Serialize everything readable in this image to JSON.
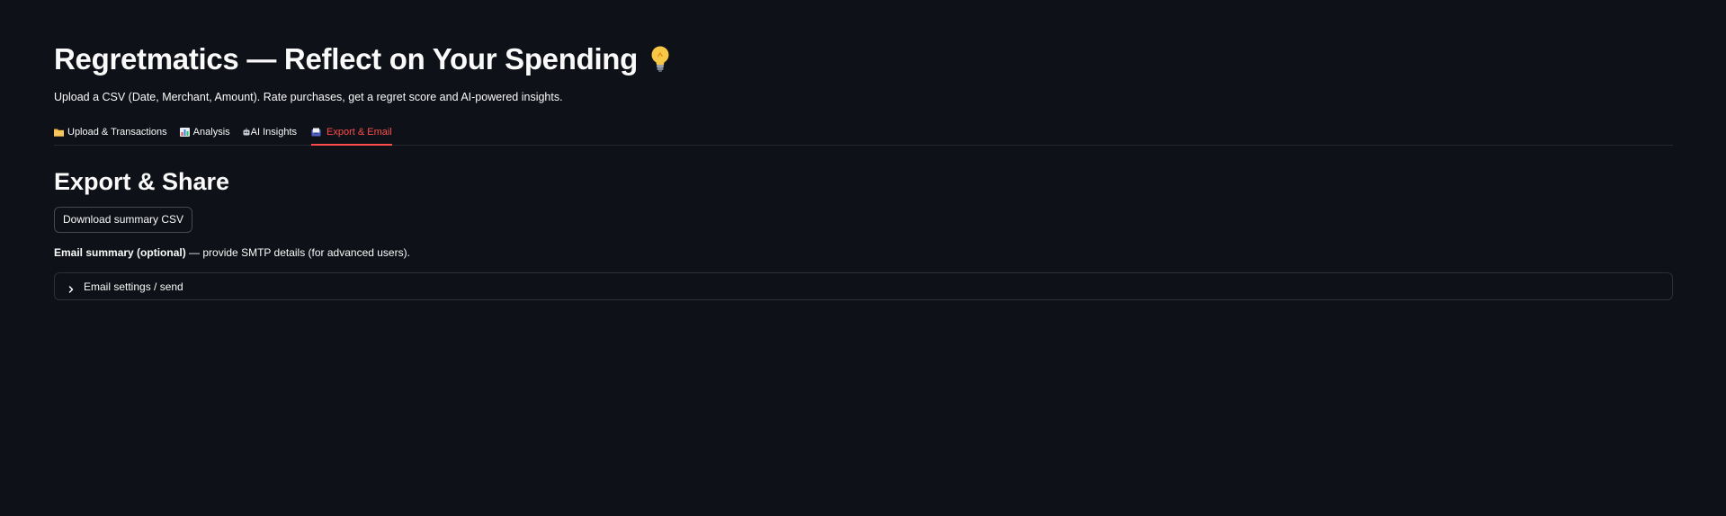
{
  "header": {
    "title": "Regretmatics — Reflect on Your Spending",
    "title_icon": "lightbulb-icon",
    "subtitle": "Upload a CSV (Date, Merchant, Amount). Rate purchases, get a regret score and AI-powered insights."
  },
  "tabs": [
    {
      "label": "Upload & Transactions",
      "icon": "folder-icon",
      "active": false
    },
    {
      "label": "Analysis",
      "icon": "bar-chart-icon",
      "active": false
    },
    {
      "label": "AI Insights",
      "icon": "robot-icon",
      "active": false
    },
    {
      "label": "Export & Email",
      "icon": "inbox-icon",
      "active": true
    }
  ],
  "export": {
    "heading": "Export & Share",
    "download_label": "Download summary CSV",
    "email_note_bold": "Email summary (optional)",
    "email_note_rest": " — provide SMTP details (for advanced users).",
    "expander_label": "Email settings / send"
  },
  "colors": {
    "background": "#0e1117",
    "text": "#fafafa",
    "accent": "#ff4b4b",
    "border": "#2e3039"
  }
}
